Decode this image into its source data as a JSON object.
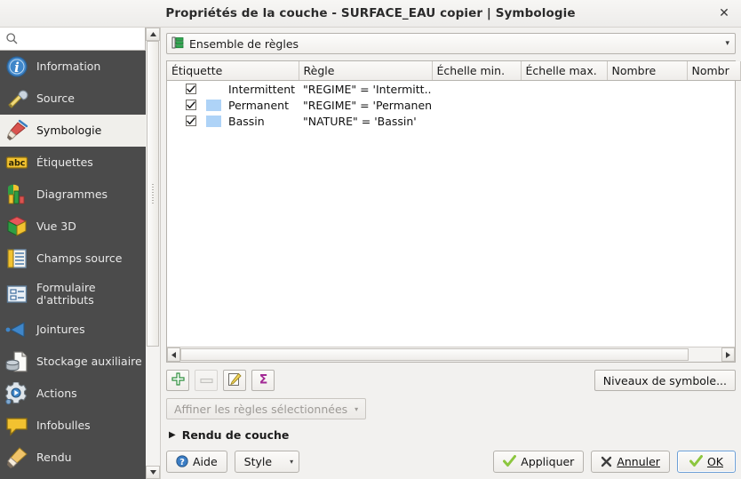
{
  "window": {
    "title": "Propriétés de la couche - SURFACE_EAU copier | Symbologie",
    "close_label": "✕"
  },
  "sidebar": {
    "search": {
      "value": "",
      "placeholder": ""
    },
    "items": [
      {
        "label": "Information",
        "icon": "information-icon",
        "selected": false
      },
      {
        "label": "Source",
        "icon": "source-icon",
        "selected": false
      },
      {
        "label": "Symbologie",
        "icon": "symbology-brush-icon",
        "selected": true
      },
      {
        "label": "Étiquettes",
        "icon": "labels-abc-icon",
        "selected": false
      },
      {
        "label": "Diagrammes",
        "icon": "diagrams-chart-icon",
        "selected": false
      },
      {
        "label": "Vue 3D",
        "icon": "3d-view-cube-icon",
        "selected": false
      },
      {
        "label": "Champs source",
        "icon": "source-fields-icon",
        "selected": false
      },
      {
        "label": "Formulaire\nd'attributs",
        "icon": "attributes-form-icon",
        "selected": false
      },
      {
        "label": "Jointures",
        "icon": "joins-icon",
        "selected": false
      },
      {
        "label": "Stockage auxiliaire",
        "icon": "auxiliary-storage-icon",
        "selected": false
      },
      {
        "label": "Actions",
        "icon": "actions-gear-icon",
        "selected": false
      },
      {
        "label": "Infobulles",
        "icon": "tooltips-balloon-icon",
        "selected": false
      },
      {
        "label": "Rendu",
        "icon": "rendering-brush-icon",
        "selected": false
      }
    ]
  },
  "renderer_combo": {
    "value": "Ensemble de règles",
    "icon": "rule-based-renderer-icon",
    "arrow": "▾"
  },
  "rules_table": {
    "columns": [
      "Étiquette",
      "Règle",
      "Échelle min.",
      "Échelle max.",
      "Nombre",
      "Nombr"
    ],
    "rows": [
      {
        "checked": true,
        "swatch": null,
        "label": "Intermittent",
        "rule": "\"REGIME\" = 'Intermitt...",
        "scale_min": "",
        "scale_max": "",
        "count": "",
        "count2": ""
      },
      {
        "checked": true,
        "swatch": "#aed3f7",
        "label": "Permanent",
        "rule": "\"REGIME\" = 'Permanent'",
        "scale_min": "",
        "scale_max": "",
        "count": "",
        "count2": ""
      },
      {
        "checked": true,
        "swatch": "#aed3f7",
        "label": "Bassin",
        "rule": "\"NATURE\" = 'Bassin'",
        "scale_min": "",
        "scale_max": "",
        "count": "",
        "count2": ""
      }
    ]
  },
  "toolbar": {
    "add_label": "",
    "add_icon": "add-plus-icon",
    "remove_label": "",
    "remove_icon": "remove-minus-icon",
    "edit_label": "",
    "edit_icon": "edit-pencil-icon",
    "count_label": "",
    "count_icon": "sigma-count-icon",
    "symbol_levels_label": "Niveaux de symbole..."
  },
  "refine": {
    "label": "Affiner les règles sélectionnées",
    "arrow": "▾"
  },
  "layer_rendering": {
    "title": "Rendu de couche",
    "triangle": "▶"
  },
  "footer": {
    "help_label": "Aide",
    "style_label": "Style",
    "style_arrow": "▾",
    "apply_label": "Appliquer",
    "cancel_label": "Annuler",
    "ok_label": "OK"
  },
  "colors": {
    "sidebar_bg": "#4b4b4b",
    "sidebar_selected_bg": "#f0efeb",
    "dialog_bg": "#f2f1ef",
    "swatch_blue": "#aed3f7",
    "check_green": "#8cc63e",
    "accent_blue": "#6c9fd6"
  }
}
